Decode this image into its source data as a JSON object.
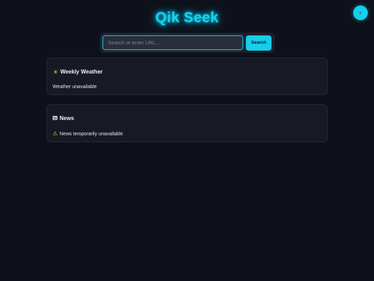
{
  "header": {
    "title": "Qik Seek",
    "theme_toggle_icon": "theme-toggle-icon",
    "accent_color": "#19d3f0"
  },
  "search": {
    "placeholder": "Search or enter URL...",
    "value": "",
    "button_label": "Search"
  },
  "weather_card": {
    "icon": "sun-icon",
    "title": "Weekly Weather",
    "message": "Weather unavailable"
  },
  "news_card": {
    "icon": "newspaper-icon",
    "title": "News",
    "status_icon": "warning-icon",
    "message": "News temporarily unavailable"
  }
}
